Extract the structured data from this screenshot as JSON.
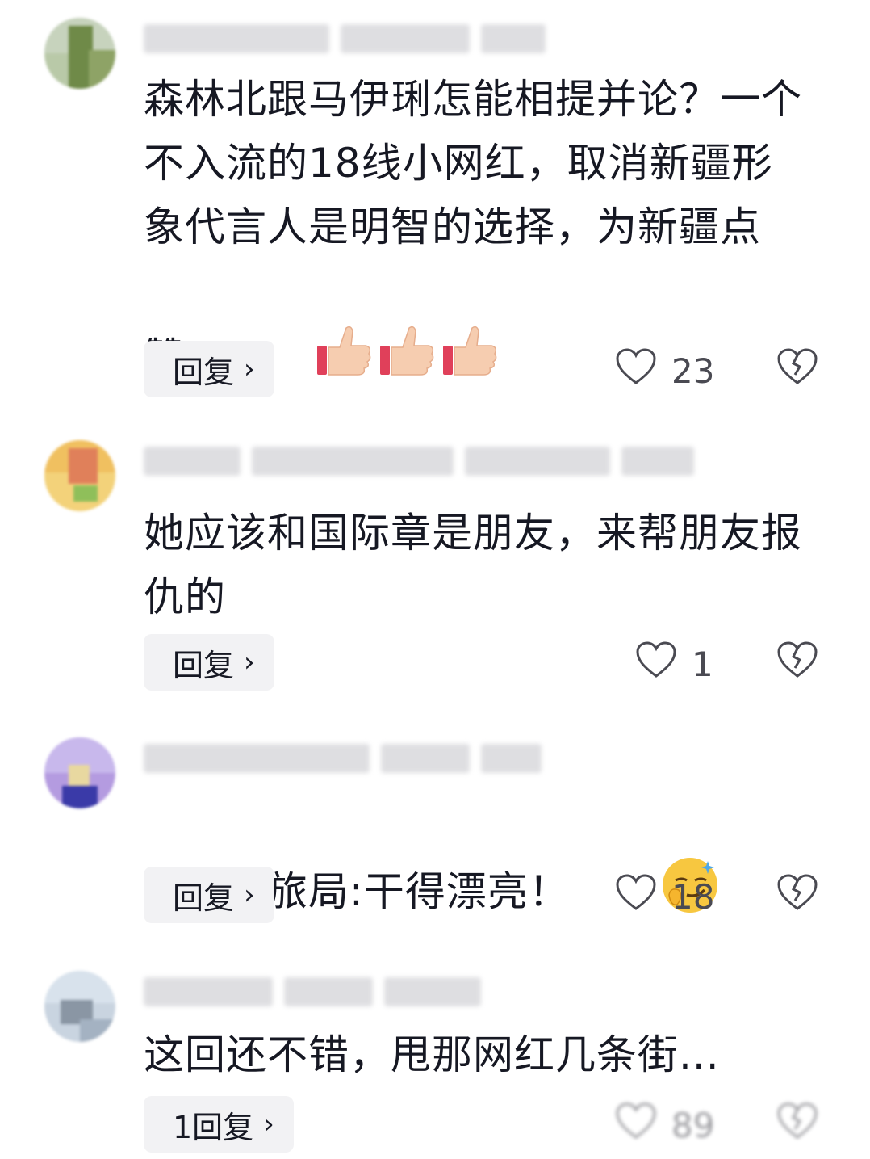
{
  "comments": [
    {
      "text": "森林北跟马伊琍怎能相提并论？一个不入流的18线小网红，取消新疆形象代言人是明智的选择，为新疆点赞！",
      "emoji": "thumbs-up-icon ×3",
      "reply_label": "回复",
      "likes": "23"
    },
    {
      "text": "她应该和国际章是朋友，来帮朋友报仇的",
      "reply_label": "回复",
      "likes": "1"
    },
    {
      "text": "新疆文旅局:干得漂亮！",
      "emoji": "smirk-face-icon",
      "reply_label": "回复",
      "likes": "18"
    },
    {
      "text": "这回还不错，甩那网红几条街...",
      "reply_label": "1回复",
      "likes": "89"
    }
  ],
  "colors": {
    "text": "#161823",
    "reply_bg": "#f2f2f4",
    "icon": "#4a4a52"
  }
}
